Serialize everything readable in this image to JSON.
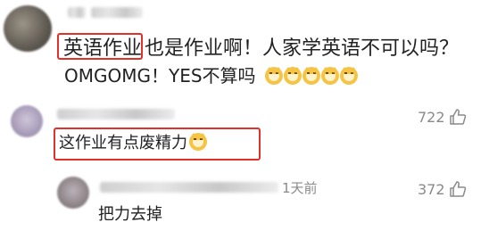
{
  "comment1": {
    "text_highlight": "英语作业",
    "text_rest": "也是作业啊！人家学英语不可以吗？",
    "text_line2": "OMGOMG！YES不算吗",
    "emoji_count": 5
  },
  "comment2": {
    "text": "这作业有点废精力",
    "likes": "722"
  },
  "reply": {
    "time": "1天前",
    "text": "把力去掉",
    "likes": "372"
  },
  "colors": {
    "highlight_border": "#e0322b",
    "meta_gray": "#8a8a8a"
  }
}
